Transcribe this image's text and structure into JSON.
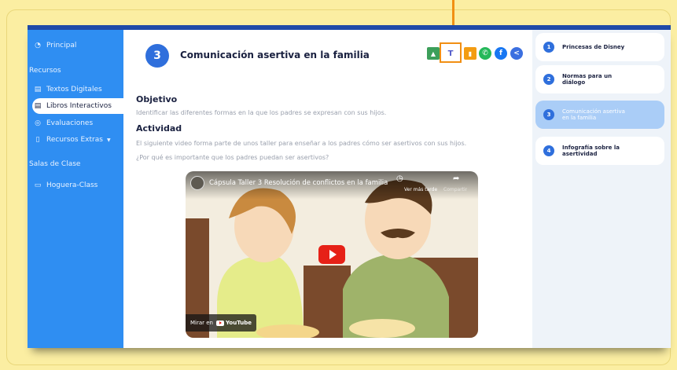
{
  "sidebar": {
    "principal": "Principal",
    "section_recursos": "Recursos",
    "items": [
      {
        "label": "Textos Digitales"
      },
      {
        "label": "Libros Interactivos"
      },
      {
        "label": "Evaluaciones"
      },
      {
        "label": "Recursos Extras"
      }
    ],
    "section_salas": "Salas de Clase",
    "room": "Hoguera-Class"
  },
  "lesson": {
    "number": "3",
    "title": "Comunicación asertiva en la familia",
    "objective_heading": "Objetivo",
    "objective_text": "Identificar las diferentes formas en la que los padres se expresan con sus hijos.",
    "activity_heading": "Actividad",
    "activity_text_1": "El siguiente video forma parte de unos taller para enseñar a los padres cómo ser asertivos con sus hijos.",
    "activity_text_2": "¿Por qué es importante que los padres puedan ser asertivos?"
  },
  "video": {
    "title": "Cápsula Taller 3 Resolución de conflictos en la familia",
    "watch_later": "Ver más tarde",
    "share": "Compartir",
    "watch_on": "Mirar en",
    "brand": "YouTube"
  },
  "lessons": [
    {
      "n": "1",
      "label": "Princesas de Disney"
    },
    {
      "n": "2",
      "label": "Normas para un diálogo"
    },
    {
      "n": "3",
      "label": "Comunicación asertiva en la familia"
    },
    {
      "n": "4",
      "label": "Infografía sobre la asertividad"
    }
  ],
  "share_icons": {
    "classroom": "google-classroom-icon",
    "teams": "teams-icon",
    "stats": "bar-chart-icon",
    "whatsapp": "whatsapp-icon",
    "facebook": "facebook-icon",
    "share": "share-icon"
  },
  "colors": {
    "background": "#fbeea2",
    "sidebar": "#2f8ef2",
    "accent": "#2f6fdc",
    "highlight": "#f18f13"
  }
}
